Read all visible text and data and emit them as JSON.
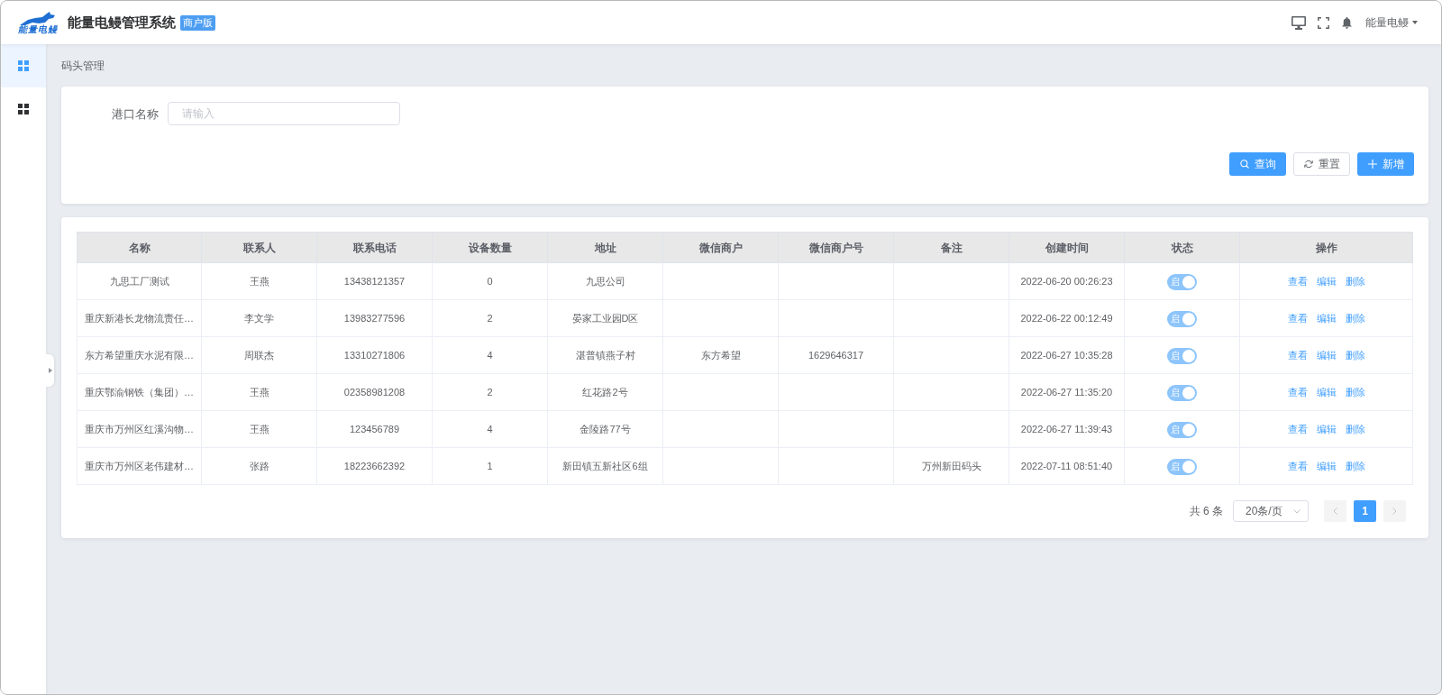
{
  "header": {
    "logo_text": "能量电鳗",
    "title": "能量电鳗管理系统",
    "badge": "商户版",
    "user": "能量电鳗"
  },
  "sidebar": {
    "items": [
      {
        "selected": true
      },
      {
        "selected": false
      }
    ]
  },
  "breadcrumb": "码头管理",
  "search_form": {
    "fields": [
      {
        "label": "港口名称",
        "placeholder": "请输入"
      }
    ],
    "buttons": [
      {
        "kind": "search",
        "label": "查询"
      },
      {
        "kind": "reset",
        "label": "重置"
      },
      {
        "kind": "add",
        "label": "新增"
      }
    ]
  },
  "table": {
    "columns": [
      "名称",
      "联系人",
      "联系电话",
      "设备数量",
      "地址",
      "微信商户",
      "微信商户号",
      "备注",
      "创建时间",
      "状态",
      "操作"
    ],
    "rows": [
      {
        "name": "九思工厂测试",
        "contact": "王燕",
        "phone": "13438121357",
        "devices": "0",
        "address": "九思公司",
        "created": "2022-06-20 00:26:23",
        "status": {
          "on": true,
          "label": "启"
        },
        "actions": [
          "查看",
          "编辑",
          "删除"
        ]
      },
      {
        "name": "重庆新港长龙物流责任…",
        "contact": "李文学",
        "phone": "13983277596",
        "devices": "2",
        "address": "晏家工业园D区",
        "created": "2022-06-22 00:12:49",
        "status": {
          "on": true,
          "label": "启"
        },
        "actions": [
          "查看",
          "编辑",
          "删除"
        ]
      },
      {
        "name": "东方希望重庆水泥有限…",
        "contact": "周联杰",
        "phone": "13310271806",
        "devices": "4",
        "address": "湛普镇燕子村",
        "wechat_merchant": "东方希望",
        "wechat_merchant_id": "1629646317",
        "created": "2022-06-27 10:35:28",
        "status": {
          "on": true,
          "label": "启"
        },
        "actions": [
          "查看",
          "编辑",
          "删除"
        ]
      },
      {
        "name": "重庆鄂渝钢铁（集团）…",
        "contact": "王燕",
        "phone": "02358981208",
        "devices": "2",
        "address": "红花路2号",
        "created": "2022-06-27 11:35:20",
        "status": {
          "on": true,
          "label": "启"
        },
        "actions": [
          "查看",
          "编辑",
          "删除"
        ]
      },
      {
        "name": "重庆市万州区红溪沟物…",
        "contact": "王燕",
        "phone": "123456789",
        "devices": "4",
        "address": "金陵路77号",
        "created": "2022-06-27 11:39:43",
        "status": {
          "on": true,
          "label": "启"
        },
        "actions": [
          "查看",
          "编辑",
          "删除"
        ]
      },
      {
        "name": "重庆市万州区老伟建材…",
        "contact": "张路",
        "phone": "18223662392",
        "devices": "1",
        "address": "新田镇五新社区6组",
        "remark": "万州新田码头",
        "created": "2022-07-11 08:51:40",
        "status": {
          "on": true,
          "label": "启"
        },
        "actions": [
          "查看",
          "编辑",
          "删除"
        ]
      }
    ]
  },
  "pagination": {
    "total": "共 6 条",
    "page_size": "20条/页",
    "pages": [
      {
        "label": "1",
        "selected": true
      }
    ]
  }
}
